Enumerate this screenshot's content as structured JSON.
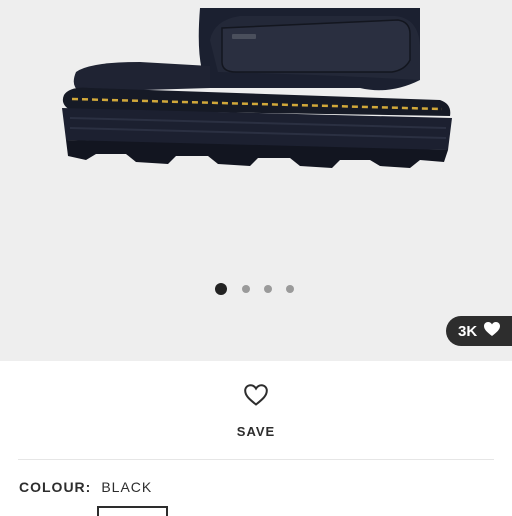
{
  "gallery": {
    "image_alt": "Black suede slide sandal with yellow-stitched chunky sole",
    "dots_count": 4,
    "active_dot_index": 0,
    "like_count": "3K"
  },
  "save": {
    "label": "SAVE"
  },
  "colour": {
    "label": "COLOUR:",
    "value": "BLACK"
  }
}
